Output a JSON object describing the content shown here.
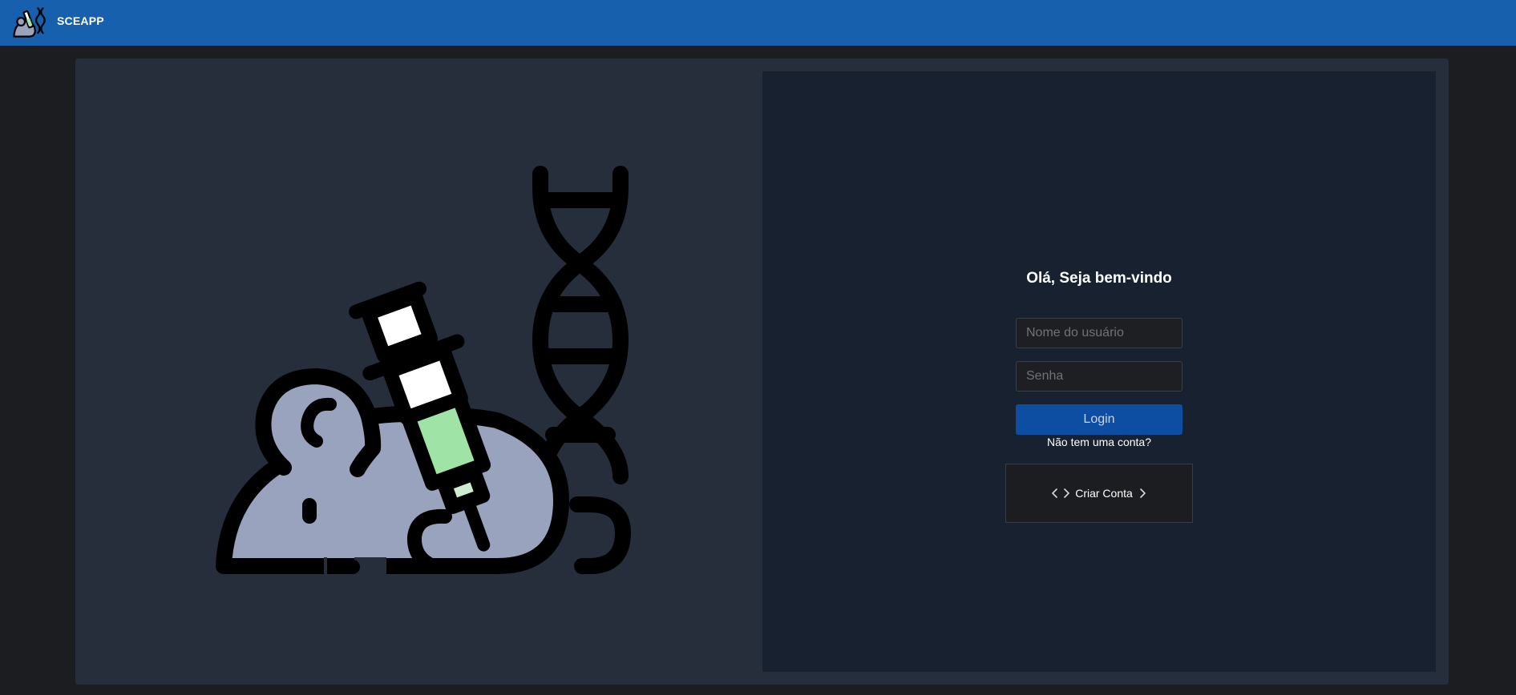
{
  "header": {
    "brand": "SCEAPP",
    "logo_icon": "lab-mouse-syringe-dna-icon",
    "background": "#1660ae"
  },
  "illustration": {
    "icon": "lab-mouse-syringe-dna-icon",
    "colors": {
      "mouse": "#9aa3bd",
      "syringe_fluid": "#a0e3a6",
      "syringe_tip": "#cdeed2",
      "outline": "#000000"
    }
  },
  "login": {
    "greeting": "Olá, Seja bem-vindo",
    "username_placeholder": "Nome do usuário",
    "password_placeholder": "Senha",
    "login_label": "Login",
    "no_account_text": "Não tem uma conta?",
    "create_account_label": "Criar Conta",
    "accent": "#0d4ea3"
  }
}
